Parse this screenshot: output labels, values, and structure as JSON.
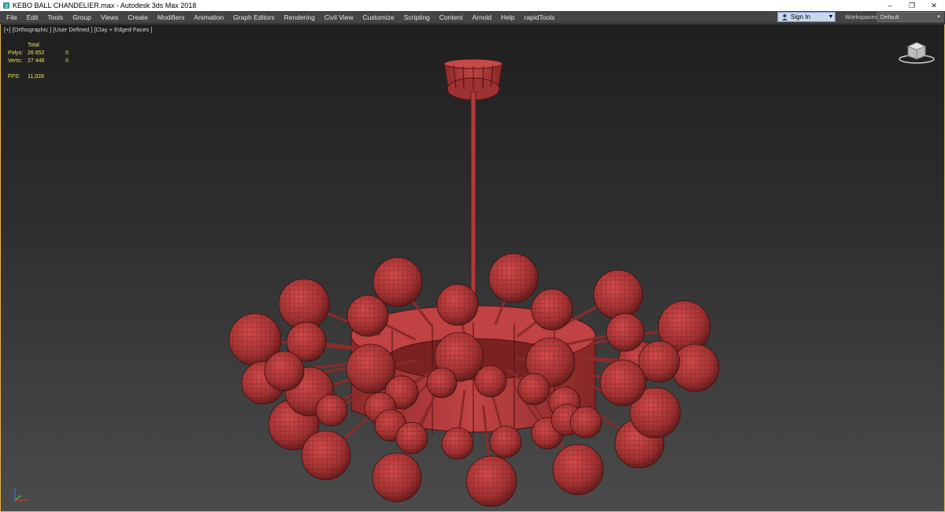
{
  "window": {
    "title": "KEBO BALL CHANDELIER.max - Autodesk 3ds Max 2018",
    "controls": {
      "minimize": "–",
      "restore": "❐",
      "close": "✕"
    }
  },
  "menu": [
    "File",
    "Edit",
    "Tools",
    "Group",
    "Views",
    "Create",
    "Modifiers",
    "Animation",
    "Graph Editors",
    "Rendering",
    "Civil View",
    "Customize",
    "Scripting",
    "Content",
    "Arnold",
    "Help",
    "rapidTools"
  ],
  "signin": {
    "label": "Sign In"
  },
  "workspaces": {
    "label": "Workspaces:",
    "value": "Default"
  },
  "viewport": {
    "label": "[+] [Orthographic ] [User Defined ] [Clay + Edged Faces ]",
    "stats": {
      "header": "Total",
      "polys_label": "Polys:",
      "polys_total": "26 652",
      "polys_sel": "0",
      "verts_label": "Verts:",
      "verts_total": "27 446",
      "verts_sel": "0",
      "fps_label": "FPS:",
      "fps_value": "11,028"
    }
  },
  "colors": {
    "model": "#b03a3a",
    "accent": "#e8b54a",
    "stats": "#e8e84c"
  },
  "icons": [
    "app-icon",
    "user-icon",
    "view-cube-icon",
    "axis-gizmo-icon"
  ]
}
